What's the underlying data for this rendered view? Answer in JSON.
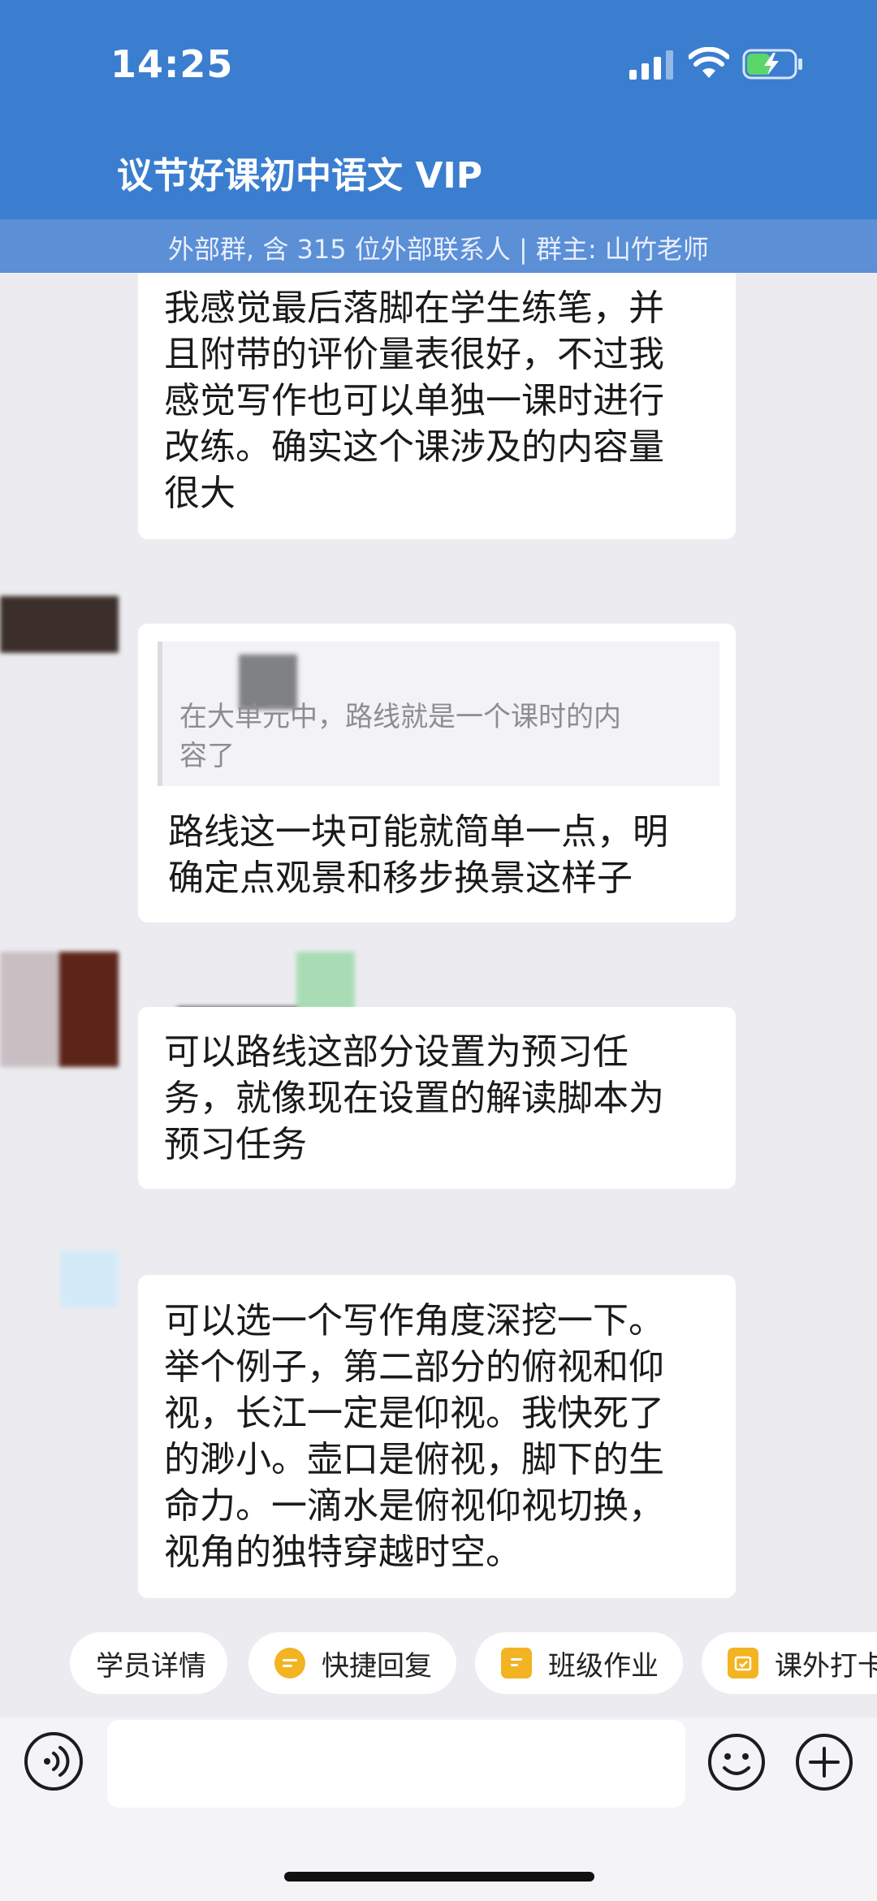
{
  "status_bar": {
    "time": "14:25"
  },
  "header": {
    "title": "议节好课初中语文 VIP",
    "subtitle": "外部群, 含 315 位外部联系人 | 群主: 山竹老师"
  },
  "messages": [
    {
      "text": "我感觉最后落脚在学生练笔，并\n且附带的评价量表很好，不过我\n感觉写作也可以单独一课时进行\n改练。确实这个课涉及的内容量\n很大"
    },
    {
      "quote": "在大单元中，路线就是一个课时的内\n容了",
      "text": "路线这一块可能就简单一点，明\n确定点观景和移步换景这样子"
    },
    {
      "text": "可以路线这部分设置为预习任\n务，就像现在设置的解读脚本为\n预习任务"
    },
    {
      "text": "可以选一个写作角度深挖一下。\n举个例子，第二部分的俯视和仰\n视，长江一定是仰视。我快死了\n的渺小。壶口是俯视，脚下的生\n命力。一滴水是俯视仰视切换，\n视角的独特穿越时空。"
    }
  ],
  "quick_actions": [
    {
      "label": "学员详情",
      "icon": "none"
    },
    {
      "label": "快捷回复",
      "icon": "quick-reply-icon"
    },
    {
      "label": "班级作业",
      "icon": "homework-icon"
    },
    {
      "label": "课外打卡",
      "icon": "calendar-icon"
    }
  ],
  "input": {
    "placeholder": ""
  },
  "colors": {
    "header_blue": "#3b7ed0",
    "accent_orange": "#f2b422",
    "background": "#ececf0"
  }
}
